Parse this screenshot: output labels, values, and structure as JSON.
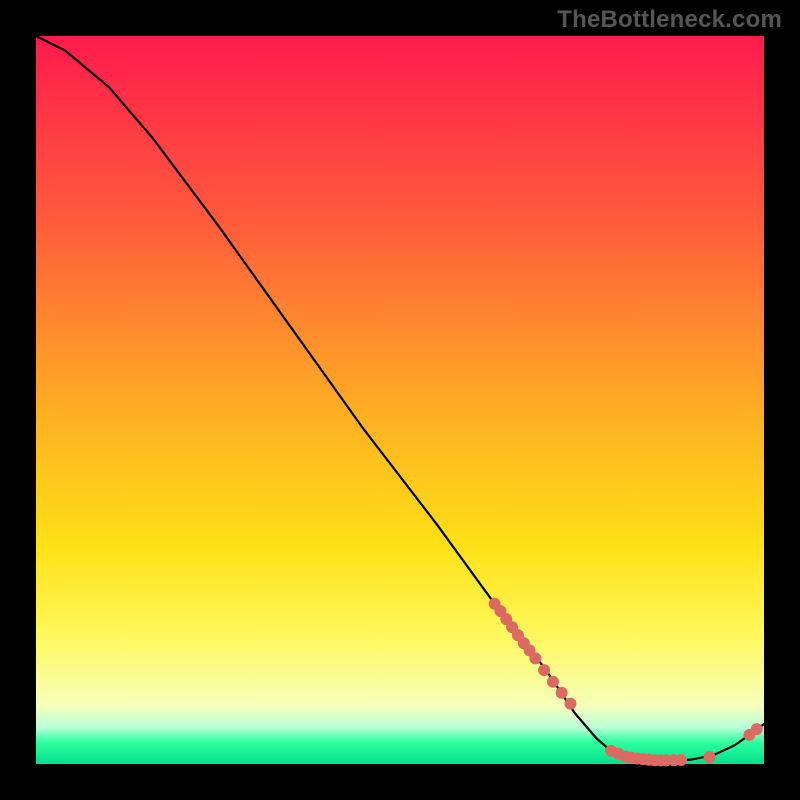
{
  "watermark": "TheBottleneck.com",
  "colors": {
    "dot": "#dd6a62",
    "line": "#000000",
    "gradient_stops": [
      "#ff1a4d",
      "#ff5a3c",
      "#ffb820",
      "#fff85a",
      "#02e08f"
    ]
  },
  "chart_data": {
    "type": "line",
    "title": "",
    "xlabel": "",
    "ylabel": "",
    "xlim": [
      0,
      100
    ],
    "ylim": [
      0,
      100
    ],
    "curve": [
      {
        "x": 0,
        "y": 100
      },
      {
        "x": 4,
        "y": 98
      },
      {
        "x": 10,
        "y": 93
      },
      {
        "x": 16,
        "y": 86
      },
      {
        "x": 25,
        "y": 74
      },
      {
        "x": 35,
        "y": 60
      },
      {
        "x": 45,
        "y": 46
      },
      {
        "x": 55,
        "y": 33
      },
      {
        "x": 63,
        "y": 22
      },
      {
        "x": 70,
        "y": 13
      },
      {
        "x": 74,
        "y": 7
      },
      {
        "x": 77,
        "y": 3.5
      },
      {
        "x": 79,
        "y": 1.8
      },
      {
        "x": 82,
        "y": 0.8
      },
      {
        "x": 86,
        "y": 0.5
      },
      {
        "x": 90,
        "y": 0.6
      },
      {
        "x": 93,
        "y": 1.2
      },
      {
        "x": 96,
        "y": 2.6
      },
      {
        "x": 98,
        "y": 4.0
      },
      {
        "x": 100,
        "y": 5.5
      }
    ],
    "dots_upper": [
      {
        "x": 63.0,
        "y": 22.0
      },
      {
        "x": 63.8,
        "y": 21.0
      },
      {
        "x": 64.6,
        "y": 19.9
      },
      {
        "x": 65.4,
        "y": 18.8
      },
      {
        "x": 66.2,
        "y": 17.7
      },
      {
        "x": 67.0,
        "y": 16.6
      },
      {
        "x": 67.8,
        "y": 15.6
      },
      {
        "x": 68.6,
        "y": 14.5
      },
      {
        "x": 69.8,
        "y": 12.9
      },
      {
        "x": 71.0,
        "y": 11.3
      },
      {
        "x": 72.2,
        "y": 9.8
      },
      {
        "x": 73.4,
        "y": 8.3
      }
    ],
    "dots_bottom": [
      {
        "x": 79.0,
        "y": 1.8
      },
      {
        "x": 80.0,
        "y": 1.4
      },
      {
        "x": 81.0,
        "y": 1.0
      },
      {
        "x": 81.8,
        "y": 0.85
      },
      {
        "x": 82.6,
        "y": 0.75
      },
      {
        "x": 83.4,
        "y": 0.65
      },
      {
        "x": 84.2,
        "y": 0.58
      },
      {
        "x": 85.0,
        "y": 0.52
      },
      {
        "x": 85.8,
        "y": 0.5
      },
      {
        "x": 86.6,
        "y": 0.5
      },
      {
        "x": 87.6,
        "y": 0.52
      },
      {
        "x": 88.6,
        "y": 0.55
      },
      {
        "x": 92.5,
        "y": 0.95
      }
    ],
    "dots_tail": [
      {
        "x": 98.0,
        "y": 4.0
      },
      {
        "x": 99.0,
        "y": 4.8
      }
    ]
  }
}
